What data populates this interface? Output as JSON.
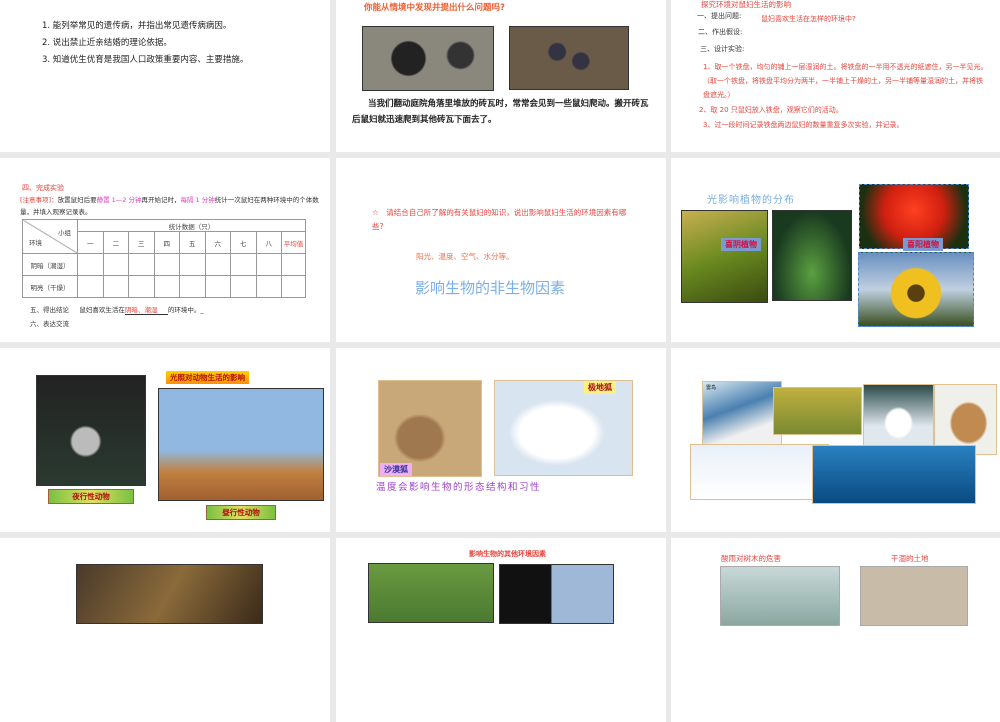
{
  "slide1": {
    "items": [
      "1. 能列举常见的遗传病，并指出常见遗传病病因。",
      "2. 说出禁止近亲结婚的理论依据。",
      "3. 知道优生优育是我国人口政策重要内容、主要措施。"
    ]
  },
  "slide2": {
    "question": "你能从情境中发现并提出什么问题吗?",
    "body": "当我们翻动庭院角落里堆放的砖瓦时，常常会见到一些鼠妇爬动。搬开砖瓦后鼠妇就迅速爬到其他砖瓦下面去了。"
  },
  "slide3": {
    "title": "探究环境对鼠妇生活的影响",
    "step1": "一、提出问题:",
    "q": "鼠妇喜欢生活在怎样的环境中?",
    "step2": "二、作出假设:",
    "step3": "三、设计实验:",
    "e1": "1、取一个铁盘，均匀的铺上一层湿润的土。将铁盘的一半用不透光的纸遮住，另一半见光。（取一个铁盘，将铁盘平均分为两半，一半铺上干燥的土，另一半铺等量湿润的土，并将铁盘遮光。）",
    "e2": "2、取 20 只鼠妇放入铁盘，观察它们的活动。",
    "e3": "3、过一段时间记录铁盘两边鼠妇的数量重复多次实验，并记录。"
  },
  "slide4": {
    "heading": "四、完成实验",
    "note_label": "[注意事项]：",
    "note_a": "放置鼠妇后要",
    "note_b": "静置 1—2 分钟",
    "note_c": "再开始记时，",
    "note_d": "每隔 1 分钟",
    "note_e": "统计一次鼠妇在两种环境中的个体数量，并填入观察记录表。",
    "table": {
      "corner_top": "小组",
      "corner_bottom": "环境",
      "group": "统计数据（只）",
      "cols": [
        "一",
        "二",
        "三",
        "四",
        "五",
        "六",
        "七",
        "八"
      ],
      "avg": "平均值",
      "rows": [
        "阴暗（潮湿）",
        "明亮（干燥）"
      ]
    },
    "conclusion_label": "五、得出结论",
    "conclusion_text": "鼠妇喜欢生活在",
    "conclusion_answer": "阴暗、潮湿",
    "conclusion_end": "的环境中。_",
    "step6": "六、表达交流"
  },
  "slide5": {
    "question": "☆　请结合自己所了解的有关鼠妇的知识，说出影响鼠妇生活的环境因素有哪些?",
    "answer": "阳光、温度、空气、水分等。",
    "title": "影响生物的非生物因素"
  },
  "slide6": {
    "title": "光影响植物的分布",
    "shade": "喜阴植物",
    "sun": "喜阳植物"
  },
  "slide7": {
    "title": "光照对动物生活的影响",
    "night": "夜行性动物",
    "day": "昼行性动物"
  },
  "slide8": {
    "desert": "沙漠狐",
    "arctic": "极地狐",
    "caption": "温度会影响生物的形态结构和习性"
  },
  "slide9": {
    "map_label": "雷鸟"
  },
  "slide11": {
    "title": "影响生物的其他环境因素"
  },
  "slide12": {
    "acid": "酸雨对树木的危害",
    "dry": "干涸的土地"
  }
}
